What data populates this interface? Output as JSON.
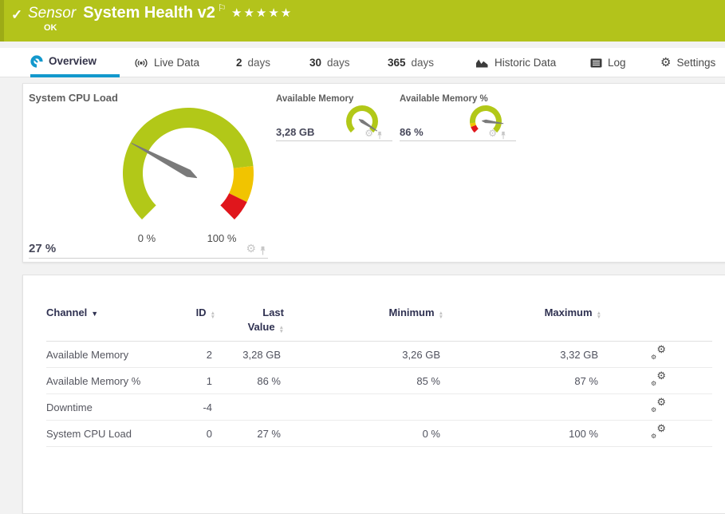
{
  "header": {
    "check": "✓",
    "kind_label": "Sensor",
    "title": "System Health v2",
    "status": "OK",
    "stars": "★★★★★",
    "color": "#b3c31b"
  },
  "tabs": [
    {
      "id": "overview",
      "icon": "gauge-icon",
      "label": "Overview",
      "active": true
    },
    {
      "id": "live-data",
      "icon": "live-icon",
      "label": "Live Data"
    },
    {
      "id": "2-days",
      "num": "2",
      "label": "days"
    },
    {
      "id": "30-days",
      "num": "30",
      "label": "days"
    },
    {
      "id": "365-days",
      "num": "365",
      "label": "days"
    },
    {
      "id": "historic-data",
      "icon": "chart-icon",
      "label": "Historic Data"
    },
    {
      "id": "log",
      "icon": "log-icon",
      "label": "Log"
    },
    {
      "id": "settings",
      "icon": "gear-icon",
      "label": "Settings"
    }
  ],
  "gauges": {
    "cpu": {
      "title": "System CPU Load",
      "value": "27 %",
      "min_label": "0 %",
      "max_label": "100 %",
      "needle_frac": 0.27,
      "segments": [
        {
          "from": 0,
          "to": 0.81,
          "color": "#b2c818"
        },
        {
          "from": 0.81,
          "to": 0.93,
          "color": "#f1c400"
        },
        {
          "from": 0.93,
          "to": 1,
          "color": "#e0161c"
        }
      ]
    },
    "mem": {
      "title": "Available Memory",
      "value": "3,28 GB",
      "needle_frac": 0.955,
      "segments": [
        {
          "from": 0,
          "to": 1,
          "color": "#b2c818"
        }
      ]
    },
    "mem_pct": {
      "title": "Available Memory %",
      "value": "86 %",
      "needle_frac": 0.86,
      "segments": [
        {
          "from": 0,
          "to": 0.09,
          "color": "#e0161c"
        },
        {
          "from": 0.09,
          "to": 0.14,
          "color": "#f1c400"
        },
        {
          "from": 0.14,
          "to": 1,
          "color": "#b2c818"
        }
      ]
    }
  },
  "table": {
    "headers": {
      "channel": "Channel",
      "id": "ID",
      "last_line1": "Last",
      "last_line2": "Value",
      "minimum": "Minimum",
      "maximum": "Maximum"
    },
    "rows": [
      {
        "channel": "Available Memory",
        "id": "2",
        "last_value": "3,28 GB",
        "minimum": "3,26 GB",
        "maximum": "3,32 GB"
      },
      {
        "channel": "Available Memory %",
        "id": "1",
        "last_value": "86 %",
        "minimum": "85 %",
        "maximum": "87 %"
      },
      {
        "channel": "Downtime",
        "id": "-4",
        "last_value": "",
        "minimum": "",
        "maximum": ""
      },
      {
        "channel": "System CPU Load",
        "id": "0",
        "last_value": "27 %",
        "minimum": "0 %",
        "maximum": "100 %"
      }
    ]
  },
  "colors": {
    "header_green": "#b3c31b",
    "accent_blue": "#1398cc",
    "gauge_green": "#b2c818",
    "gauge_yellow": "#f1c400",
    "gauge_red": "#e0161c"
  }
}
